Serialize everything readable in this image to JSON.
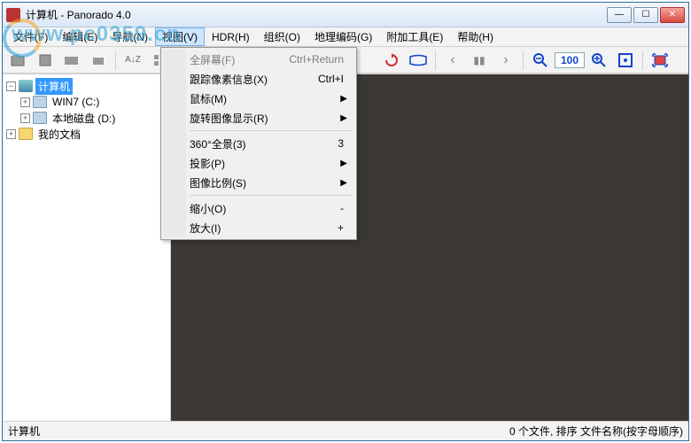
{
  "title": "计算机 - Panorado 4.0",
  "watermark": "www.pc0359.cn",
  "menubar": [
    {
      "label": "文件(F)"
    },
    {
      "label": "编辑(E)"
    },
    {
      "label": "导航(N)"
    },
    {
      "label": "视图(V)",
      "open": true
    },
    {
      "label": "HDR(H)"
    },
    {
      "label": "组织(O)"
    },
    {
      "label": "地理编码(G)"
    },
    {
      "label": "附加工具(E)"
    },
    {
      "label": "帮助(H)"
    }
  ],
  "dropdown": [
    {
      "label": "全屏幕(F)",
      "shortcut": "Ctrl+Return",
      "disabled": true
    },
    {
      "label": "跟踪像素信息(X)",
      "shortcut": "Ctrl+I"
    },
    {
      "label": "鼠标(M)",
      "submenu": true
    },
    {
      "label": "旋转图像显示(R)",
      "submenu": true
    },
    {
      "sep": true
    },
    {
      "label": "360°全景(3)",
      "shortcut": "3"
    },
    {
      "label": "投影(P)",
      "submenu": true
    },
    {
      "label": "图像比例(S)",
      "submenu": true
    },
    {
      "sep": true
    },
    {
      "label": "缩小(O)",
      "shortcut": "-"
    },
    {
      "label": "放大(I)",
      "shortcut": "+"
    }
  ],
  "toolbar": {
    "zoom_label": "100"
  },
  "tree": {
    "root": "计算机",
    "drive_c": "WIN7 (C:)",
    "drive_d": "本地磁盘 (D:)",
    "docs": "我的文档"
  },
  "status": {
    "left": "计算机",
    "right": "0 个文件, 排序 文件名称(按字母顺序)"
  }
}
